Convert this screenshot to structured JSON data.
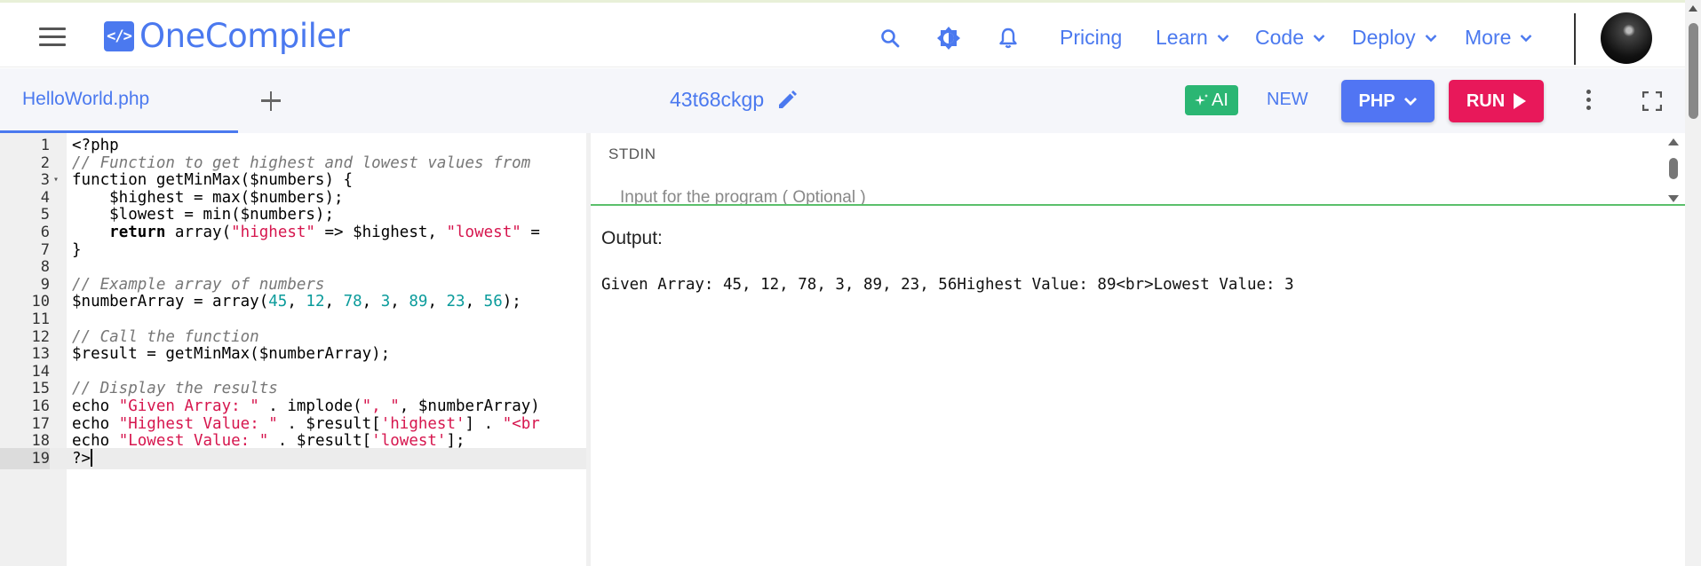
{
  "header": {
    "logo_glyph": "</>",
    "logo_text": "OneCompiler",
    "nav": [
      {
        "label": "Pricing",
        "has_dropdown": false
      },
      {
        "label": "Learn",
        "has_dropdown": true
      },
      {
        "label": "Code",
        "has_dropdown": true
      },
      {
        "label": "Deploy",
        "has_dropdown": true
      },
      {
        "label": "More",
        "has_dropdown": true
      }
    ],
    "icons": [
      "menu-icon",
      "search-icon",
      "theme-toggle-icon",
      "notification-bell-icon",
      "user-avatar"
    ]
  },
  "toolbar": {
    "file_tab": "HelloWorld.php",
    "code_id": "43t68ckgp",
    "ai_label": "AI",
    "new_label": "NEW",
    "language": "PHP",
    "run_label": "RUN"
  },
  "editor": {
    "language": "php",
    "active_line": 19,
    "lines": [
      "<?php",
      "// Function to get highest and lowest values from",
      "function getMinMax($numbers) {",
      "    $highest = max($numbers);",
      "    $lowest = min($numbers);",
      "    return array(\"highest\" => $highest, \"lowest\" =",
      "}",
      "",
      "// Example array of numbers",
      "$numberArray = array(45, 12, 78, 3, 89, 23, 56);",
      "",
      "// Call the function",
      "$result = getMinMax($numberArray);",
      "",
      "// Display the results",
      "echo \"Given Array: \" . implode(\", \", $numberArray)",
      "echo \"Highest Value: \" . $result['highest'] . \"<br",
      "echo \"Lowest Value: \" . $result['lowest'];",
      "?>"
    ]
  },
  "stdin": {
    "label": "STDIN",
    "placeholder": "Input for the program ( Optional )"
  },
  "output": {
    "label": "Output:",
    "text": "Given Array: 45, 12, 78, 3, 89, 23, 56Highest Value: 89<br>Lowest Value: 3"
  },
  "colors": {
    "brand": "#4b79ef",
    "ai": "#2bb673",
    "run": "#e8185a",
    "language": "#5175f3",
    "string": "#d6164e",
    "number": "#0a9b9b",
    "comment": "#777777"
  }
}
